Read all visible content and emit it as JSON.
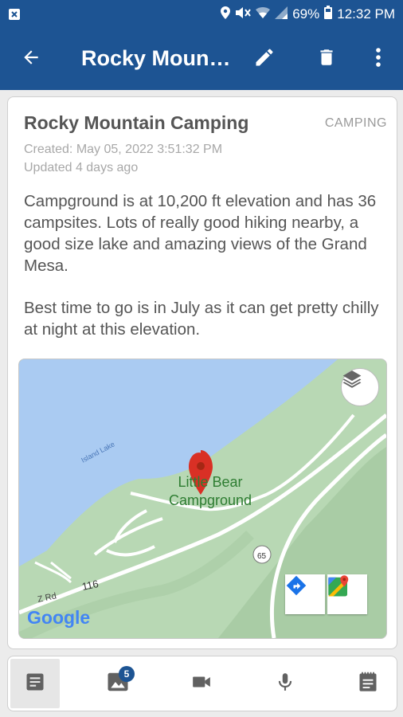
{
  "status_bar": {
    "battery": "69%",
    "time": "12:32 PM",
    "icons": [
      "notification-icon",
      "location-icon",
      "mute-icon",
      "wifi-icon",
      "signal-icon",
      "battery-icon"
    ]
  },
  "app_bar": {
    "title": "Rocky Moun…",
    "icons": [
      "back-arrow-icon",
      "edit-pencil-icon",
      "delete-trash-icon",
      "more-vert-icon"
    ]
  },
  "note": {
    "title": "Rocky Mountain Camping",
    "category": "CAMPING",
    "created": "Created: May 05, 2022  3:51:32 PM",
    "updated": "Updated 4 days ago",
    "paragraphs": [
      "Campground is at 10,200 ft elevation and has 36 campsites. Lots of really good hiking nearby, a good size lake and amazing views of the Grand Mesa.",
      "Best time to go is in July as it can get pretty chilly at night at this elevation."
    ]
  },
  "map": {
    "lake_label": "Island Lake",
    "place_name_line1": "Little Bear",
    "place_name_line2": "Campground",
    "road_label_1": "65",
    "road_label_2": "116",
    "road_label_3": "Z Rd",
    "logo_text": "Google",
    "colors": {
      "water": "#aacbf2",
      "land": "#b8d8b4",
      "pin": "#d93025"
    }
  },
  "bottom_tabs": {
    "photos_badge": "5",
    "icons": [
      "note-text-icon",
      "photo-icon",
      "video-icon",
      "mic-icon",
      "notepad-icon"
    ]
  },
  "colors": {
    "primary": "#1d5493",
    "text": "#555555",
    "meta": "#a8a8a8"
  }
}
